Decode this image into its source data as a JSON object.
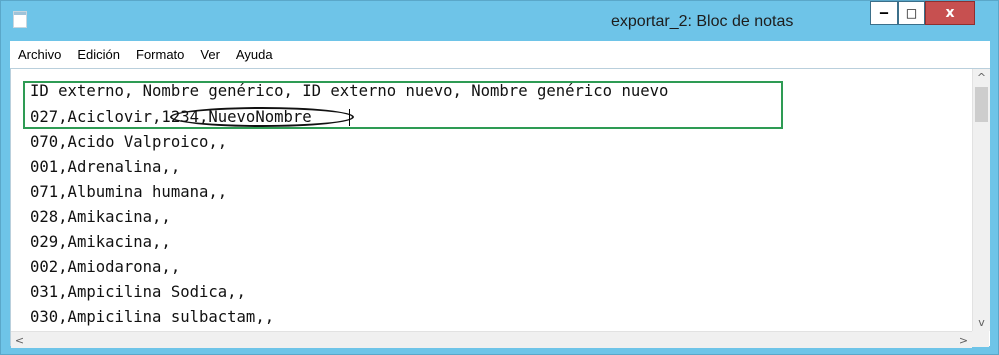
{
  "window": {
    "title": "exportar_2: Bloc de notas",
    "icon": "notepad-icon",
    "controls": {
      "minimize": "‒",
      "maximize": "□",
      "close": "x"
    }
  },
  "menubar": {
    "items": [
      "Archivo",
      "Edición",
      "Formato",
      "Ver",
      "Ayuda"
    ]
  },
  "editor": {
    "lines": [
      "ID externo, Nombre genérico, ID externo nuevo, Nombre genérico nuevo",
      "027,Aciclovir,1234,NuevoNombre",
      "070,Acido Valproico,,",
      "001,Adrenalina,,",
      "071,Albumina humana,,",
      "028,Amikacina,,",
      "029,Amikacina,,",
      "002,Amiodarona,,",
      "031,Ampicilina Sodica,,",
      "030,Ampicilina sulbactam,,"
    ]
  },
  "scrollbars": {
    "up_arrow": "^",
    "down_arrow": "v",
    "left_arrow": "<",
    "right_arrow": ">"
  },
  "colors": {
    "titlebar": "#6ec4e8",
    "close_button": "#c75050",
    "highlight_box": "#2e9b54",
    "annotation_circle": "#111111"
  }
}
